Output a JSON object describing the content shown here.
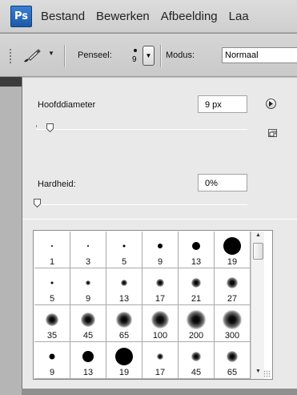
{
  "app": {
    "logo": "Ps"
  },
  "menu": [
    "Bestand",
    "Bewerken",
    "Afbeelding",
    "Laa"
  ],
  "options_bar": {
    "tool_icon": "brush-icon",
    "brush_label": "Penseel:",
    "brush_size": "9",
    "mode_label": "Modus:",
    "mode_value": "Normaal"
  },
  "brush_panel": {
    "diameter_label": "Hoofddiameter",
    "diameter_value": "9 px",
    "hardness_label": "Hardheid:",
    "hardness_value": "0%",
    "menu_icon": "play-arrow-icon",
    "new_preset_icon": "new-preset-icon",
    "presets": [
      {
        "size": "1",
        "kind": "hard",
        "dot": 2
      },
      {
        "size": "3",
        "kind": "hard",
        "dot": 2
      },
      {
        "size": "5",
        "kind": "hard",
        "dot": 3
      },
      {
        "size": "9",
        "kind": "hard",
        "dot": 6
      },
      {
        "size": "13",
        "kind": "hard",
        "dot": 10
      },
      {
        "size": "19",
        "kind": "hard",
        "dot": 22
      },
      {
        "size": "5",
        "kind": "soft",
        "dot": 4
      },
      {
        "size": "9",
        "kind": "soft",
        "dot": 6
      },
      {
        "size": "13",
        "kind": "soft",
        "dot": 8
      },
      {
        "size": "17",
        "kind": "soft",
        "dot": 10
      },
      {
        "size": "21",
        "kind": "soft",
        "dot": 12
      },
      {
        "size": "27",
        "kind": "soft",
        "dot": 14
      },
      {
        "size": "35",
        "kind": "soft",
        "dot": 16
      },
      {
        "size": "45",
        "kind": "soft",
        "dot": 18
      },
      {
        "size": "65",
        "kind": "soft",
        "dot": 20
      },
      {
        "size": "100",
        "kind": "soft",
        "dot": 22
      },
      {
        "size": "200",
        "kind": "soft",
        "dot": 24
      },
      {
        "size": "300",
        "kind": "soft",
        "dot": 24
      },
      {
        "size": "9",
        "kind": "hard",
        "dot": 7
      },
      {
        "size": "13",
        "kind": "hard",
        "dot": 14
      },
      {
        "size": "19",
        "kind": "hard",
        "dot": 22
      },
      {
        "size": "17",
        "kind": "soft",
        "dot": 8
      },
      {
        "size": "45",
        "kind": "soft",
        "dot": 12
      },
      {
        "size": "65",
        "kind": "soft",
        "dot": 14
      }
    ]
  }
}
